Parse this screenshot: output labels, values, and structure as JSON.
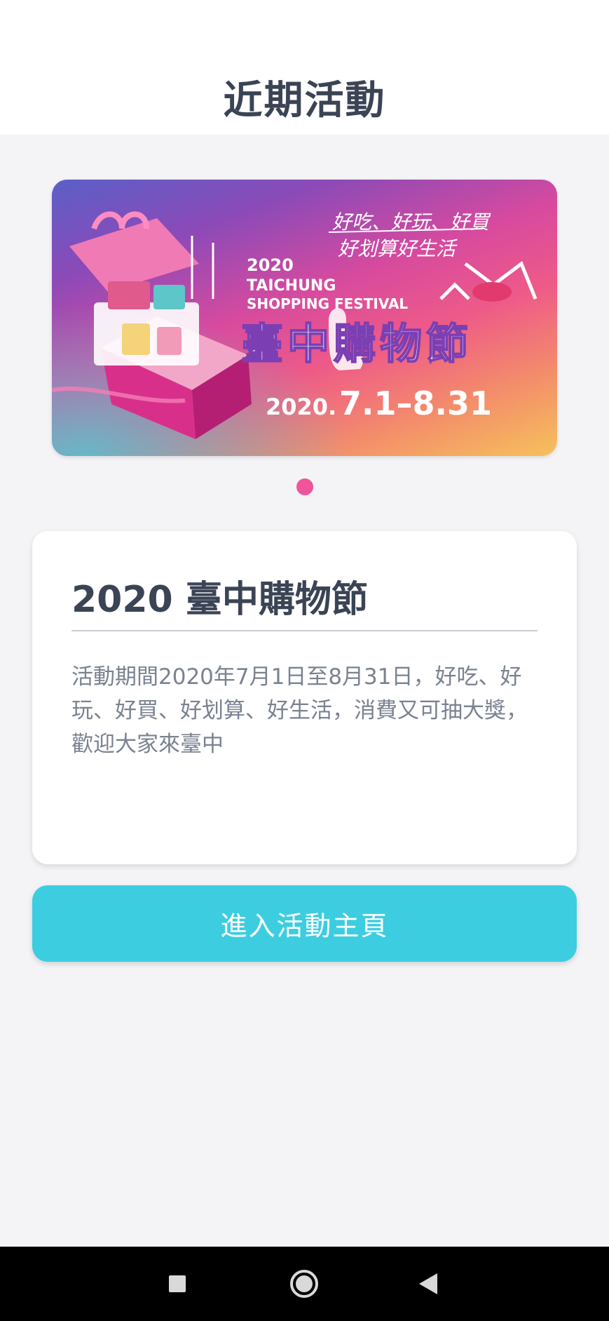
{
  "header": {
    "title": "近期活動"
  },
  "banner": {
    "year": "2020",
    "title_en_line1": "TAICHUNG",
    "title_en_line2": "SHOPPING FESTIVAL",
    "tagline_line1": "好吃、好玩、好買",
    "tagline_line2": "好划算好生活",
    "title_zh": "臺中購物節",
    "date_prefix": "2020.",
    "date_range": "7.1–8.31"
  },
  "carousel": {
    "current_page": 1,
    "total_pages": 1
  },
  "event_card": {
    "title": "2020 臺中購物節",
    "description": "活動期間2020年7月1日至8月31日，好吃、好玩、好買、好划算、好生活，消費又可抽大獎，歡迎大家來臺中"
  },
  "cta": {
    "label": "進入活動主頁"
  },
  "navbar": {
    "icons": [
      "recent-apps-icon",
      "home-icon",
      "back-icon"
    ]
  },
  "colors": {
    "accent_pink": "#f0549a",
    "button_cyan": "#3ccde0",
    "title_dark": "#3a4455",
    "text_gray": "#7a8290"
  }
}
